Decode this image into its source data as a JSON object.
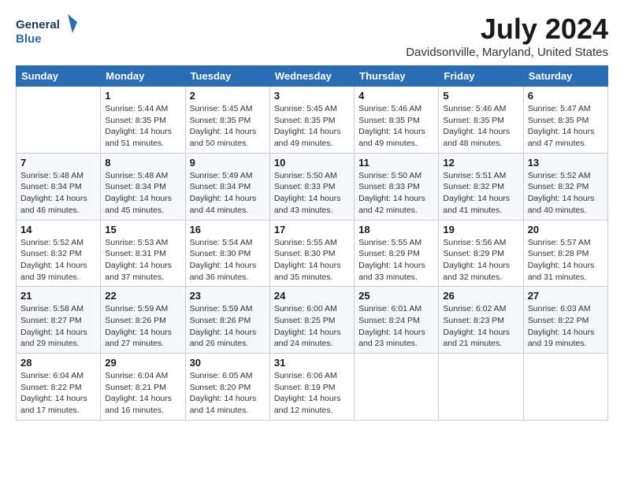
{
  "logo": {
    "line1": "General",
    "line2": "Blue"
  },
  "title": "July 2024",
  "subtitle": "Davidsonville, Maryland, United States",
  "days_of_week": [
    "Sunday",
    "Monday",
    "Tuesday",
    "Wednesday",
    "Thursday",
    "Friday",
    "Saturday"
  ],
  "weeks": [
    [
      {
        "day": "",
        "info": ""
      },
      {
        "day": "1",
        "info": "Sunrise: 5:44 AM\nSunset: 8:35 PM\nDaylight: 14 hours\nand 51 minutes."
      },
      {
        "day": "2",
        "info": "Sunrise: 5:45 AM\nSunset: 8:35 PM\nDaylight: 14 hours\nand 50 minutes."
      },
      {
        "day": "3",
        "info": "Sunrise: 5:45 AM\nSunset: 8:35 PM\nDaylight: 14 hours\nand 49 minutes."
      },
      {
        "day": "4",
        "info": "Sunrise: 5:46 AM\nSunset: 8:35 PM\nDaylight: 14 hours\nand 49 minutes."
      },
      {
        "day": "5",
        "info": "Sunrise: 5:46 AM\nSunset: 8:35 PM\nDaylight: 14 hours\nand 48 minutes."
      },
      {
        "day": "6",
        "info": "Sunrise: 5:47 AM\nSunset: 8:35 PM\nDaylight: 14 hours\nand 47 minutes."
      }
    ],
    [
      {
        "day": "7",
        "info": "Sunrise: 5:48 AM\nSunset: 8:34 PM\nDaylight: 14 hours\nand 46 minutes."
      },
      {
        "day": "8",
        "info": "Sunrise: 5:48 AM\nSunset: 8:34 PM\nDaylight: 14 hours\nand 45 minutes."
      },
      {
        "day": "9",
        "info": "Sunrise: 5:49 AM\nSunset: 8:34 PM\nDaylight: 14 hours\nand 44 minutes."
      },
      {
        "day": "10",
        "info": "Sunrise: 5:50 AM\nSunset: 8:33 PM\nDaylight: 14 hours\nand 43 minutes."
      },
      {
        "day": "11",
        "info": "Sunrise: 5:50 AM\nSunset: 8:33 PM\nDaylight: 14 hours\nand 42 minutes."
      },
      {
        "day": "12",
        "info": "Sunrise: 5:51 AM\nSunset: 8:32 PM\nDaylight: 14 hours\nand 41 minutes."
      },
      {
        "day": "13",
        "info": "Sunrise: 5:52 AM\nSunset: 8:32 PM\nDaylight: 14 hours\nand 40 minutes."
      }
    ],
    [
      {
        "day": "14",
        "info": "Sunrise: 5:52 AM\nSunset: 8:32 PM\nDaylight: 14 hours\nand 39 minutes."
      },
      {
        "day": "15",
        "info": "Sunrise: 5:53 AM\nSunset: 8:31 PM\nDaylight: 14 hours\nand 37 minutes."
      },
      {
        "day": "16",
        "info": "Sunrise: 5:54 AM\nSunset: 8:30 PM\nDaylight: 14 hours\nand 36 minutes."
      },
      {
        "day": "17",
        "info": "Sunrise: 5:55 AM\nSunset: 8:30 PM\nDaylight: 14 hours\nand 35 minutes."
      },
      {
        "day": "18",
        "info": "Sunrise: 5:55 AM\nSunset: 8:29 PM\nDaylight: 14 hours\nand 33 minutes."
      },
      {
        "day": "19",
        "info": "Sunrise: 5:56 AM\nSunset: 8:29 PM\nDaylight: 14 hours\nand 32 minutes."
      },
      {
        "day": "20",
        "info": "Sunrise: 5:57 AM\nSunset: 8:28 PM\nDaylight: 14 hours\nand 31 minutes."
      }
    ],
    [
      {
        "day": "21",
        "info": "Sunrise: 5:58 AM\nSunset: 8:27 PM\nDaylight: 14 hours\nand 29 minutes."
      },
      {
        "day": "22",
        "info": "Sunrise: 5:59 AM\nSunset: 8:26 PM\nDaylight: 14 hours\nand 27 minutes."
      },
      {
        "day": "23",
        "info": "Sunrise: 5:59 AM\nSunset: 8:26 PM\nDaylight: 14 hours\nand 26 minutes."
      },
      {
        "day": "24",
        "info": "Sunrise: 6:00 AM\nSunset: 8:25 PM\nDaylight: 14 hours\nand 24 minutes."
      },
      {
        "day": "25",
        "info": "Sunrise: 6:01 AM\nSunset: 8:24 PM\nDaylight: 14 hours\nand 23 minutes."
      },
      {
        "day": "26",
        "info": "Sunrise: 6:02 AM\nSunset: 8:23 PM\nDaylight: 14 hours\nand 21 minutes."
      },
      {
        "day": "27",
        "info": "Sunrise: 6:03 AM\nSunset: 8:22 PM\nDaylight: 14 hours\nand 19 minutes."
      }
    ],
    [
      {
        "day": "28",
        "info": "Sunrise: 6:04 AM\nSunset: 8:22 PM\nDaylight: 14 hours\nand 17 minutes."
      },
      {
        "day": "29",
        "info": "Sunrise: 6:04 AM\nSunset: 8:21 PM\nDaylight: 14 hours\nand 16 minutes."
      },
      {
        "day": "30",
        "info": "Sunrise: 6:05 AM\nSunset: 8:20 PM\nDaylight: 14 hours\nand 14 minutes."
      },
      {
        "day": "31",
        "info": "Sunrise: 6:06 AM\nSunset: 8:19 PM\nDaylight: 14 hours\nand 12 minutes."
      },
      {
        "day": "",
        "info": ""
      },
      {
        "day": "",
        "info": ""
      },
      {
        "day": "",
        "info": ""
      }
    ]
  ]
}
